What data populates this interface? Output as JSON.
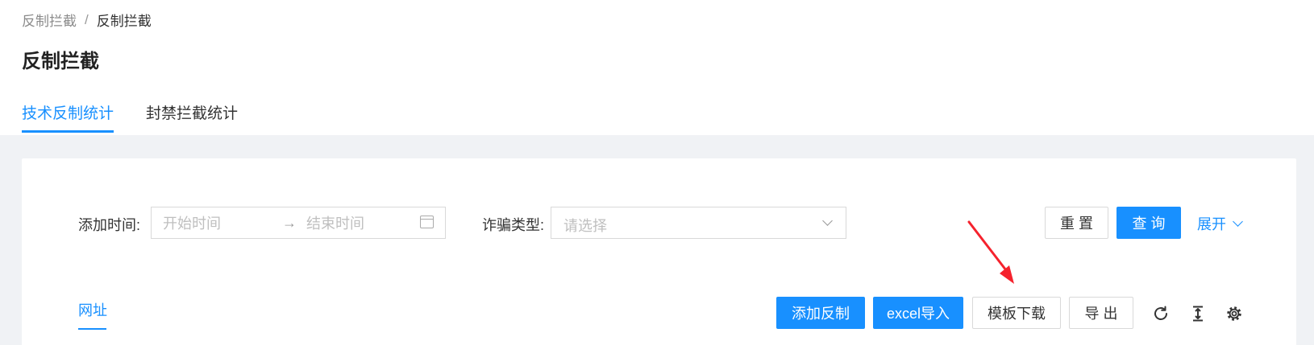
{
  "breadcrumb": {
    "parent": "反制拦截",
    "separator": "/",
    "current": "反制拦截"
  },
  "page": {
    "title": "反制拦截"
  },
  "tabs": [
    {
      "label": "技术反制统计",
      "active": true
    },
    {
      "label": "封禁拦截统计",
      "active": false
    }
  ],
  "filters": {
    "time_label": "添加时间:",
    "start_placeholder": "开始时间",
    "range_arrow": "→",
    "end_placeholder": "结束时间",
    "type_label": "诈骗类型:",
    "type_placeholder": "请选择"
  },
  "actions": {
    "reset": "重 置",
    "query": "查 询",
    "expand": "展开"
  },
  "subtab": {
    "label": "网址"
  },
  "toolbar": {
    "add": "添加反制",
    "import": "excel导入",
    "template": "模板下载",
    "export": "导 出"
  },
  "icons": [
    "reload-icon",
    "column-height-icon",
    "setting-icon"
  ],
  "colors": {
    "primary": "#1890ff",
    "annotation": "#f5222d"
  }
}
